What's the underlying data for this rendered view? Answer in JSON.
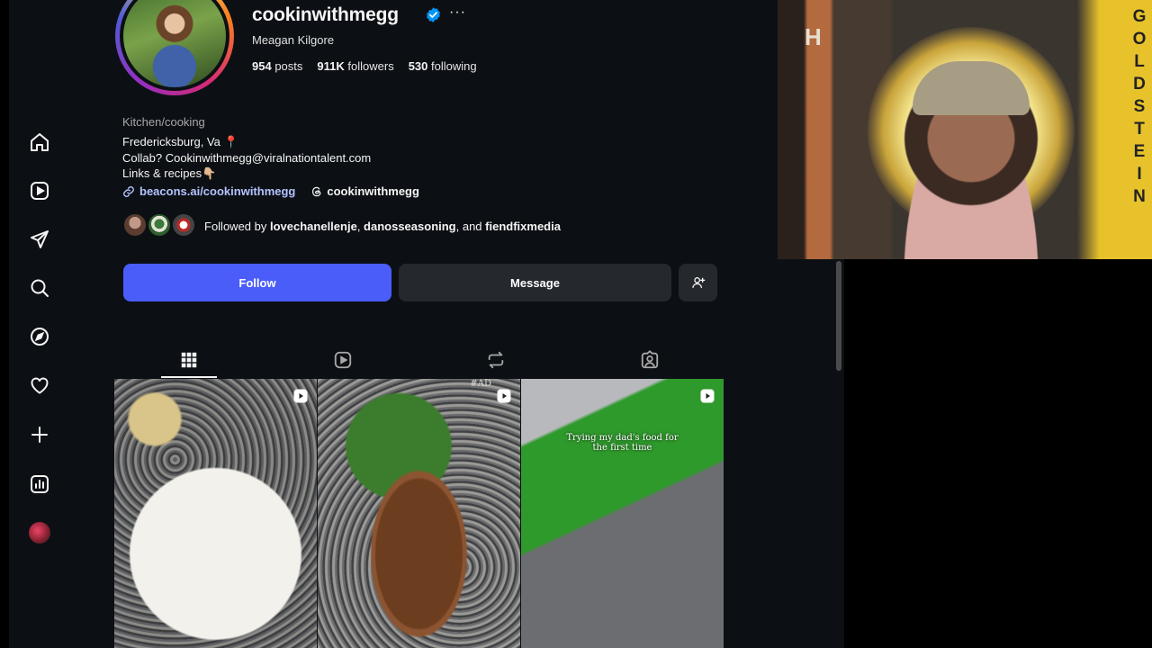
{
  "profile": {
    "username": "cookinwithmegg",
    "more": "···",
    "full_name": "Meagan Kilgore",
    "stats": {
      "posts_count": "954",
      "posts_label": "posts",
      "followers_count": "911K",
      "followers_label": "followers",
      "following_count": "530",
      "following_label": "following"
    },
    "category": "Kitchen/cooking",
    "bio": {
      "line1": "Fredericksburg, Va 📍",
      "line2": "Collab? Cookinwithmegg@viralnationtalent.com",
      "line3": "Links & recipes👇🏼"
    },
    "link": "beacons.ai/cookinwithmegg",
    "threads_handle": "cookinwithmegg",
    "followed_by": {
      "prefix": "Followed by ",
      "user1": "lovechanellenje",
      "sep1": ", ",
      "user2": "danosseasoning",
      "sep2": ", and ",
      "user3": "fiendfixmedia"
    }
  },
  "buttons": {
    "follow": "Follow",
    "message": "Message"
  },
  "tabs": [
    {
      "icon": "grid-icon",
      "active": true
    },
    {
      "icon": "reels-icon",
      "active": false
    },
    {
      "icon": "reposts-icon",
      "active": false
    },
    {
      "icon": "tagged-icon",
      "active": false
    }
  ],
  "posts": [
    {
      "type": "reel",
      "caption": "",
      "tag": ""
    },
    {
      "type": "reel",
      "caption": "",
      "tag": "#AD"
    },
    {
      "type": "reel",
      "caption": "Trying my dad's food for the first time",
      "tag": ""
    }
  ],
  "sidebar": {
    "items": [
      "home-icon",
      "reels-icon",
      "messages-icon",
      "search-icon",
      "explore-icon",
      "notifications-icon",
      "create-icon",
      "dashboard-icon",
      "profile-avatar"
    ]
  },
  "webcam": {
    "sign_letters": "GOLDSTEIN",
    "left_letter": "H"
  },
  "colors": {
    "background": "#0c1014",
    "follow_button": "#4a5df9",
    "secondary_button": "#25292e",
    "link": "#b4c3ff",
    "verified": "#0095f6"
  }
}
